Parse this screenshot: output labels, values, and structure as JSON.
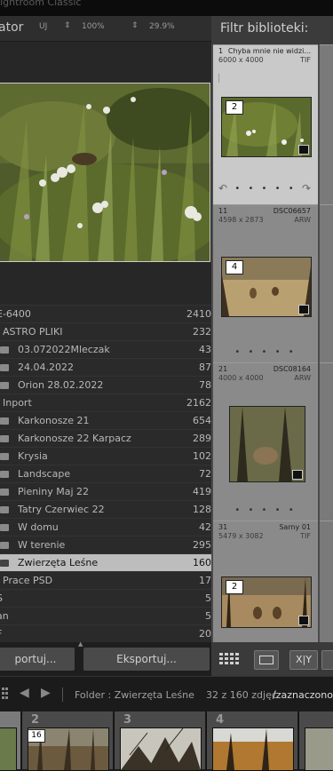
{
  "window": {
    "title": "Lightroom Classic"
  },
  "navigator": {
    "title": "ator",
    "zoom_fit": "UJ",
    "zoom_a": "100%",
    "zoom_b": "29.9%"
  },
  "folders": [
    {
      "name": "E-6400",
      "count": "2410",
      "level": 0,
      "icon": false,
      "selected": false
    },
    {
      "name": "ASTRO PLIKI",
      "count": "232",
      "level": 1,
      "icon": false,
      "selected": false
    },
    {
      "name": "03.072022Mleczak",
      "count": "43",
      "level": 2,
      "icon": true,
      "selected": false
    },
    {
      "name": "24.04.2022",
      "count": "87",
      "level": 2,
      "icon": true,
      "selected": false
    },
    {
      "name": "Orion 28.02.2022",
      "count": "78",
      "level": 2,
      "icon": true,
      "selected": false
    },
    {
      "name": "Inport",
      "count": "2162",
      "level": 1,
      "icon": false,
      "selected": false
    },
    {
      "name": "Karkonosze 21",
      "count": "654",
      "level": 2,
      "icon": true,
      "selected": false
    },
    {
      "name": "Karkonosze 22 Karpacz",
      "count": "289",
      "level": 2,
      "icon": true,
      "selected": false
    },
    {
      "name": "Krysia",
      "count": "102",
      "level": 2,
      "icon": true,
      "selected": false
    },
    {
      "name": "Landscape",
      "count": "72",
      "level": 2,
      "icon": true,
      "selected": false
    },
    {
      "name": "Pieniny Maj 22",
      "count": "419",
      "level": 2,
      "icon": true,
      "selected": false
    },
    {
      "name": "Tatry Czerwiec 22",
      "count": "128",
      "level": 2,
      "icon": true,
      "selected": false
    },
    {
      "name": "W domu",
      "count": "42",
      "level": 2,
      "icon": true,
      "selected": false
    },
    {
      "name": "W terenie",
      "count": "295",
      "level": 2,
      "icon": true,
      "selected": false
    },
    {
      "name": "Zwierzęta Leśne",
      "count": "160",
      "level": 2,
      "icon": true,
      "selected": true
    },
    {
      "name": "Prace PSD",
      "count": "17",
      "level": 1,
      "icon": false,
      "selected": false
    },
    {
      "name": "S",
      "count": "5",
      "level": 0,
      "icon": false,
      "selected": false
    },
    {
      "name": "an",
      "count": "5",
      "level": 0,
      "icon": false,
      "selected": false
    },
    {
      "name": "F",
      "count": "20",
      "level": 0,
      "icon": false,
      "selected": false
    }
  ],
  "buttons": {
    "import": "portuj...",
    "export": "Eksportuj..."
  },
  "library_filter": {
    "title": "Filtr biblioteki:"
  },
  "grid": [
    {
      "num": "1",
      "name": "Chyba mnie nie widzi...",
      "dims": "6000 x 4000",
      "ext": "TIF",
      "badge": "2",
      "selected": true
    },
    {
      "num": "11",
      "name": "DSC06657",
      "dims": "4598 x 2873",
      "ext": "ARW",
      "badge": "4",
      "selected": false
    },
    {
      "num": "21",
      "name": "DSC08164",
      "dims": "4000 x 4000",
      "ext": "ARW",
      "badge": "",
      "selected": false
    },
    {
      "num": "31",
      "name": "Sarny 01",
      "dims": "5479 x 3082",
      "ext": "TIF",
      "badge": "2",
      "selected": false
    }
  ],
  "toolbar": {
    "xy": "X|Y"
  },
  "filmstrip": {
    "folder_info": "Folder : Zwierzęta Leśne",
    "count_info": "32 z 160 zdjęć",
    "selected_info": "/zaznaczono",
    "cells": [
      {
        "num": "2",
        "badge": "16"
      },
      {
        "num": "3",
        "badge": ""
      },
      {
        "num": "4",
        "badge": ""
      }
    ]
  },
  "colors": {
    "selected_folder": "#bdbdbd",
    "grid_bg": "#4b4b4b",
    "panel_bg": "#2a2a2a"
  }
}
